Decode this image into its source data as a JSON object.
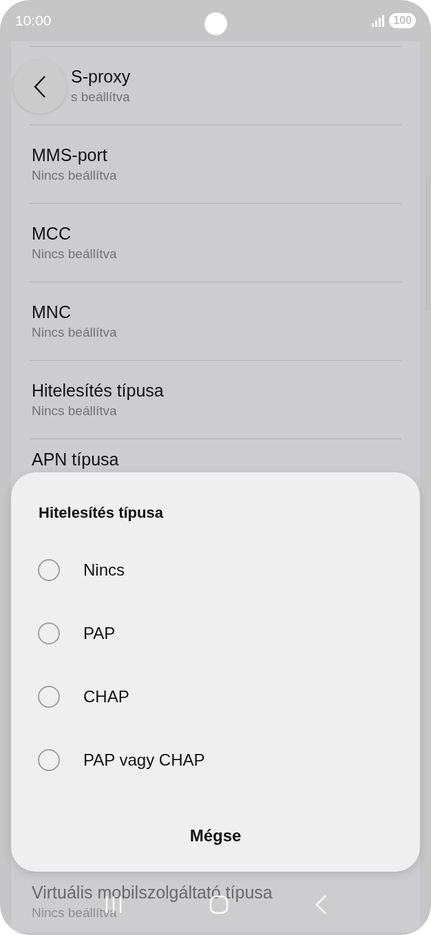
{
  "status_bar": {
    "time": "10:00",
    "battery": "100"
  },
  "settings_list": [
    {
      "title": "S-proxy",
      "subtitle": "s beállítva",
      "kind": "covered"
    },
    {
      "title": "MMS-port",
      "subtitle": "Nincs beállítva",
      "kind": "row"
    },
    {
      "title": "MCC",
      "subtitle": "Nincs beállítva",
      "kind": "row"
    },
    {
      "title": "MNC",
      "subtitle": "Nincs beállítva",
      "kind": "row"
    },
    {
      "title": "Hitelesítés típusa",
      "subtitle": "Nincs beállítva",
      "kind": "row"
    },
    {
      "title": "APN típusa",
      "kind": "row"
    },
    {
      "title": "Virtuális mobilszolgáltató típusa",
      "subtitle": "Nincs beállítva",
      "kind": "bottom"
    }
  ],
  "dialog": {
    "title": "Hitelesítés típusa",
    "options": [
      {
        "label": "Nincs",
        "selected": false
      },
      {
        "label": "PAP",
        "selected": false
      },
      {
        "label": "CHAP",
        "selected": false
      },
      {
        "label": "PAP vagy CHAP",
        "selected": false
      }
    ],
    "cancel": "Mégse"
  }
}
